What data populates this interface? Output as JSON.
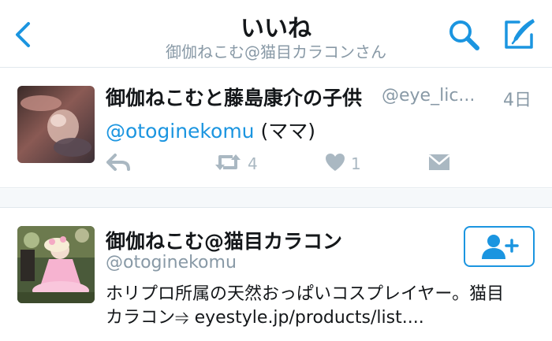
{
  "nav": {
    "title": "いいね",
    "subtitle": "御伽ねこむ@猫目カラコンさん"
  },
  "tweet": {
    "author_name": "御伽ねこむと藤島康介の子供",
    "author_handle": "@eye_lic...",
    "time": "4日",
    "mention": "@otoginekomu",
    "text_rest": " (ママ)",
    "retweet_count": "4",
    "like_count": "1"
  },
  "user": {
    "name": "御伽ねこむ@猫目カラコン",
    "handle": "@otoginekomu",
    "bio_line1": "ホリプロ所属の天然おっぱいコスプレイヤー。猫目",
    "bio_line2": "カラコン⥤ eyestyle.jp/products/list...."
  },
  "colors": {
    "accent": "#1b95e0",
    "secondary_text": "#8899a6",
    "action_icon": "#aab8c2"
  },
  "icons": [
    "back-chevron-icon",
    "search-icon",
    "compose-icon",
    "reply-icon",
    "retweet-icon",
    "heart-icon",
    "direct-message-icon",
    "add-user-icon"
  ]
}
